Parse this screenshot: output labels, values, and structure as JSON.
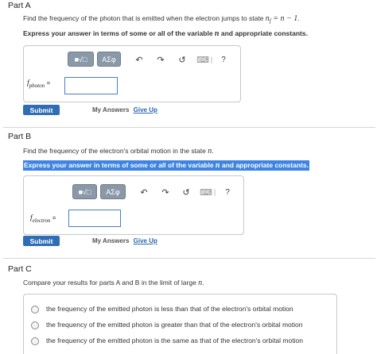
{
  "partA": {
    "title": "Part A",
    "question_prefix": "Find the frequency of the photon that is emitted when the electron jumps to state ",
    "question_math": "n",
    "question_math_sub": "f",
    "question_math_rest": " = n − 1",
    "question_end": ".",
    "instruction_prefix": "Express your answer in terms of some or all of the variable ",
    "instruction_var": "n",
    "instruction_suffix": " and appropriate constants.",
    "answer_label_main": "f",
    "answer_label_sub": "photon",
    "equals": "=",
    "submit": "Submit",
    "my_answers": "My Answers",
    "give_up": "Give Up"
  },
  "partB": {
    "title": "Part B",
    "question_prefix": "Find the frequency of the electron's orbital motion in the state ",
    "question_var": "n",
    "question_end": ".",
    "instruction_prefix": "Express your answer in terms of some or all of the variable ",
    "instruction_var": "n",
    "instruction_suffix": " and appropriate constants.",
    "answer_label_main": "f",
    "answer_label_sub": "electron",
    "equals": "=",
    "submit": "Submit",
    "my_answers": "My Answers",
    "give_up": "Give Up"
  },
  "partC": {
    "title": "Part C",
    "question_prefix": "Compare your results for parts A and B in the limit of large ",
    "question_var": "n",
    "question_end": ".",
    "options": [
      "the frequency of the emitted photon is less than that of the electron's orbital motion",
      "the frequency of the emitted photon is greater than that of the electron's orbital motion",
      "the frequency of the emitted photon is the same as that of the electron's orbital motion"
    ]
  },
  "toolbar": {
    "templates_label": "■√□",
    "symbols_label": "ΑΣφ",
    "undo": "↶",
    "redo": "↷",
    "reset": "↺",
    "keyboard": "⌨",
    "separator": "|",
    "help": "?"
  },
  "colors": {
    "accent": "#2f6eb5",
    "highlight": "#3e84e2",
    "toolbar_button": "#8a98a8"
  }
}
